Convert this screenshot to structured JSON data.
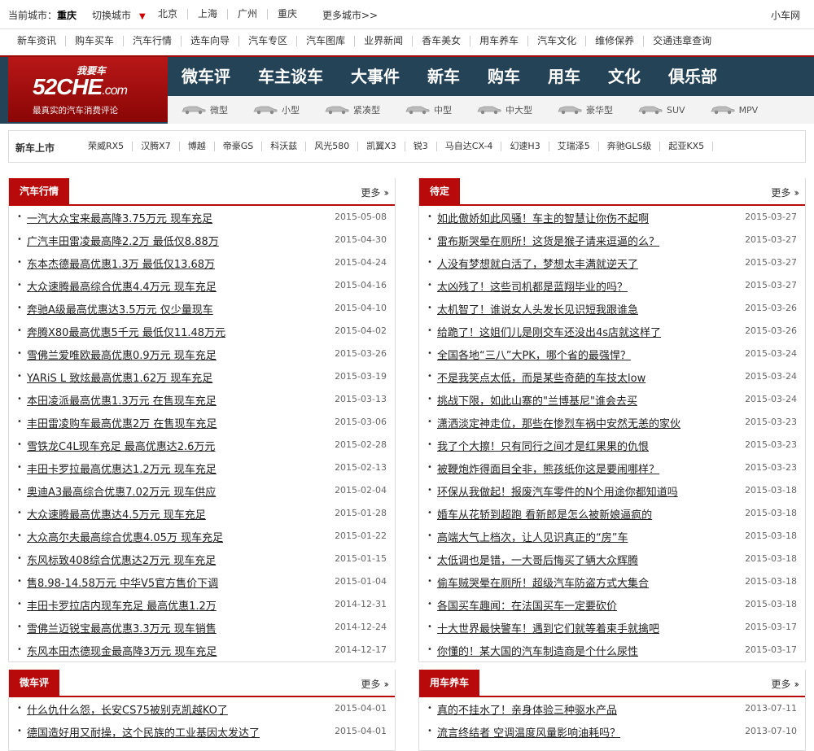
{
  "topbar": {
    "current_label": "当前城市：",
    "current_city": "重庆",
    "switch_label": "切换城市",
    "cities": [
      "北京",
      "上海",
      "广州",
      "重庆"
    ],
    "more_label": "更多城市>>",
    "site_name": "小车网"
  },
  "main_nav": [
    "新车资讯",
    "购车买车",
    "汽车行情",
    "选车向导",
    "汽车专区",
    "汽车图库",
    "业界新闻",
    "香车美女",
    "用车养车",
    "汽车文化",
    "维修保养",
    "交通违章查询"
  ],
  "logo": {
    "line1": "我要车",
    "line2": "52CHE",
    "line2_suffix": ".com",
    "slogan": "最真实的汽车消费评论"
  },
  "big_nav": [
    "微车评",
    "车主谈车",
    "大事件",
    "新车",
    "购车",
    "用车",
    "文化",
    "俱乐部"
  ],
  "car_types": [
    "微型",
    "小型",
    "紧凑型",
    "中型",
    "中大型",
    "豪华型",
    "SUV",
    "MPV"
  ],
  "new_cars": {
    "label": "新车上市",
    "items": [
      "荣威RX5",
      "汉腾X7",
      "博越",
      "帝豪GS",
      "科沃兹",
      "风光580",
      "凯翼X3",
      "锐3",
      "马自达CX-4",
      "幻速H3",
      "艾瑞泽5",
      "奔驰GLS级",
      "起亚KX5"
    ]
  },
  "more_text": "更多",
  "panels": {
    "market": {
      "title": "汽车行情",
      "items": [
        {
          "title": "一汽大众宝来最高降3.75万元 现车充足",
          "date": "2015-05-08"
        },
        {
          "title": "广汽丰田雷凌最高降2.2万 最低仅8.88万",
          "date": "2015-04-30"
        },
        {
          "title": "东本杰德最高优惠1.3万 最低仅13.68万",
          "date": "2015-04-24"
        },
        {
          "title": "大众速腾最高综合优惠4.4万元 现车充足",
          "date": "2015-04-16"
        },
        {
          "title": "奔驰A级最高优惠达3.5万元 仅少量现车",
          "date": "2015-04-10"
        },
        {
          "title": "奔腾X80最高优惠5千元 最低仅11.48万元",
          "date": "2015-04-02"
        },
        {
          "title": "雪佛兰爱唯欧最高优惠0.9万元 现车充足",
          "date": "2015-03-26"
        },
        {
          "title": "YARiS L 致炫最高优惠1.62万 现车充足",
          "date": "2015-03-19"
        },
        {
          "title": "本田凌派最高优惠1.3万元 在售现车充足",
          "date": "2015-03-13"
        },
        {
          "title": "丰田雷凌购车最高优惠2万 在售现车充足",
          "date": "2015-03-06"
        },
        {
          "title": "雪铁龙C4L现车充足 最高优惠达2.6万元",
          "date": "2015-02-28"
        },
        {
          "title": "丰田卡罗拉最高优惠达1.2万元 现车充足",
          "date": "2015-02-13"
        },
        {
          "title": "奥迪A3最高综合优惠7.02万元 现车供应",
          "date": "2015-02-04"
        },
        {
          "title": "大众速腾最高优惠达4.5万元 现车充足",
          "date": "2015-01-28"
        },
        {
          "title": "大众高尔夫最高综合优惠4.05万 现车充足",
          "date": "2015-01-22"
        },
        {
          "title": "东风标致408综合优惠达2万元 现车充足",
          "date": "2015-01-15"
        },
        {
          "title": "售8.98-14.58万元 中华V5官方售价下调",
          "date": "2015-01-04"
        },
        {
          "title": "丰田卡罗拉店内现车充足 最高优惠1.2万",
          "date": "2014-12-31"
        },
        {
          "title": "雪佛兰迈锐宝最高优惠3.3万元 现车销售",
          "date": "2014-12-24"
        },
        {
          "title": "东风本田杰德现金最高降3万元 现车充足",
          "date": "2014-12-17"
        }
      ]
    },
    "pending": {
      "title": "待定",
      "items": [
        {
          "title": "如此傲娇如此风骚！车主的智慧让你伤不起啊",
          "date": "2015-03-27"
        },
        {
          "title": "雷布斯哭晕在厕所！这货是猴子请来逗逼的么？",
          "date": "2015-03-27"
        },
        {
          "title": "人没有梦想就白活了，梦想太丰满就逆天了",
          "date": "2015-03-27"
        },
        {
          "title": "太凶残了！这些司机都是蓝翔毕业的吗？",
          "date": "2015-03-27"
        },
        {
          "title": "太机智了！谁说女人头发长见识短我跟谁急",
          "date": "2015-03-26"
        },
        {
          "title": "给跪了！这姐们儿是刚交车还没出4s店就这样了",
          "date": "2015-03-26"
        },
        {
          "title": "全国各地“三八”大PK，哪个省的最强悍？",
          "date": "2015-03-24"
        },
        {
          "title": "不是我笑点太低，而是某些奇葩的车技太low",
          "date": "2015-03-24"
        },
        {
          "title": "挑战下限，如此山寨的\"兰博基尼\"谁会去买",
          "date": "2015-03-24"
        },
        {
          "title": "潇洒淡定神走位，那些在惨烈车祸中安然无恙的家伙",
          "date": "2015-03-23"
        },
        {
          "title": "我了个大擦！只有同行之间才是红果果的仇恨",
          "date": "2015-03-23"
        },
        {
          "title": "被鞭炮炸得面目全非，熊孩纸你这是要闹哪样？",
          "date": "2015-03-23"
        },
        {
          "title": "环保从我做起！报废汽车零件的N个用途你都知道吗",
          "date": "2015-03-18"
        },
        {
          "title": "婚车从花轿到超跑 看新郎是怎么被新娘逼疯的",
          "date": "2015-03-18"
        },
        {
          "title": "高端大气上档次，让人见识真正的“房”车",
          "date": "2015-03-18"
        },
        {
          "title": "太低调也是错，一大哥后悔买了辆大众辉腾",
          "date": "2015-03-18"
        },
        {
          "title": "偷车贼哭晕在厕所！超级汽车防盗方式大集合",
          "date": "2015-03-18"
        },
        {
          "title": "各国买车趣闻：在法国买车一定要砍价",
          "date": "2015-03-18"
        },
        {
          "title": "十大世界最快警车！遇到它们就等着束手就擒吧",
          "date": "2015-03-17"
        },
        {
          "title": "你懂的！某大国的汽车制造商是个什么尿性",
          "date": "2015-03-17"
        }
      ]
    },
    "review": {
      "title": "微车评",
      "items": [
        {
          "title": "什么仇什么怨，长安CS75被别克凯越KO了",
          "date": "2015-04-01"
        },
        {
          "title": "德国造好用又耐操，这个民族的工业基因太发达了",
          "date": "2015-04-01"
        }
      ]
    },
    "care": {
      "title": "用车养车",
      "items": [
        {
          "title": "真的不挂水了！亲身体验三种驱水产品",
          "date": "2013-07-11"
        },
        {
          "title": "流言终结者 空调温度风量影响油耗吗？",
          "date": "2013-07-10"
        }
      ]
    }
  }
}
